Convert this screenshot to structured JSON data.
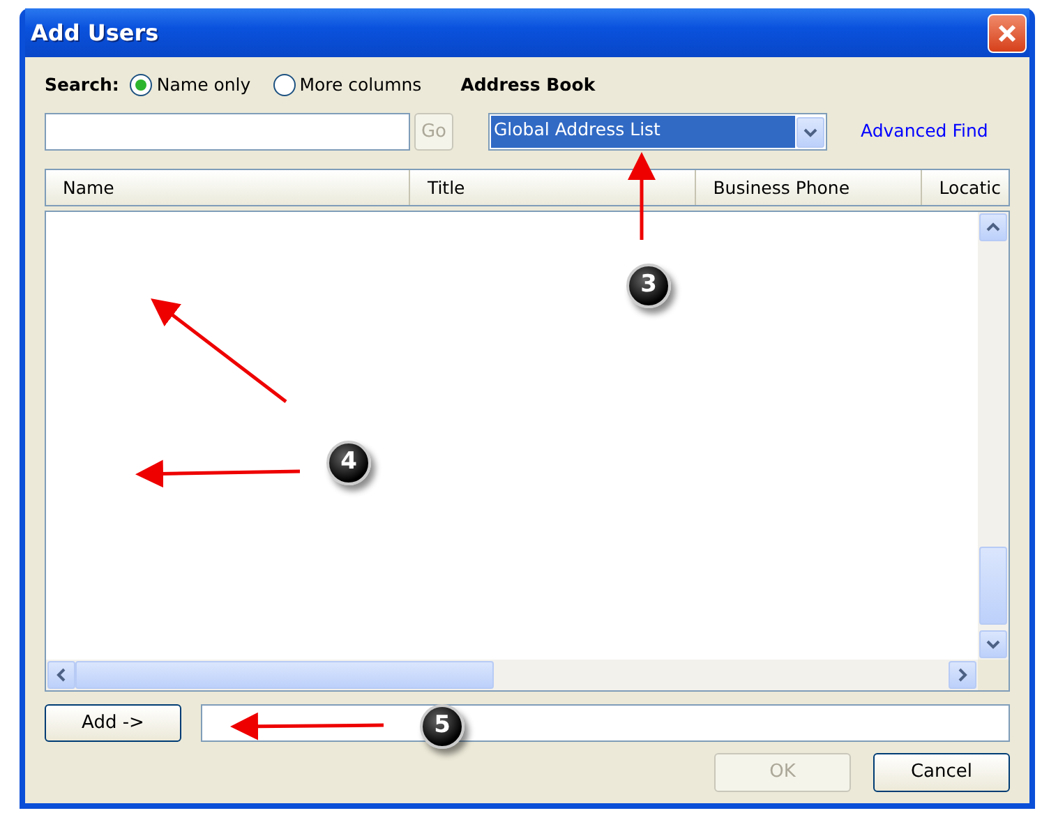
{
  "window": {
    "title": "Add Users"
  },
  "search": {
    "label": "Search:",
    "options": [
      {
        "label": "Name only",
        "selected": true
      },
      {
        "label": "More columns",
        "selected": false
      }
    ],
    "go_button": {
      "label": "Go",
      "disabled": true
    }
  },
  "address_book": {
    "label": "Address Book",
    "value": "Global Address List",
    "advanced_link": "Advanced Find"
  },
  "table": {
    "columns": [
      "Name",
      "Title",
      "Business Phone",
      "Locatic"
    ]
  },
  "add_button": {
    "label": "Add ->",
    "disabled": false
  },
  "buttons": [
    {
      "label": "OK",
      "disabled": true
    },
    {
      "label": "Cancel",
      "disabled": false
    }
  ],
  "annotations": [
    {
      "number": "3"
    },
    {
      "number": "4"
    },
    {
      "number": "5"
    }
  ]
}
